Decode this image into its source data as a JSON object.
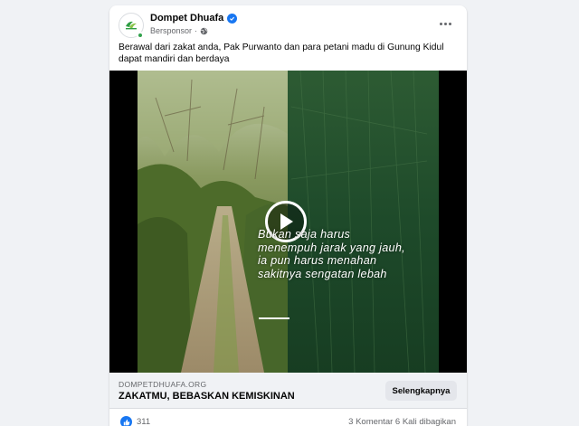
{
  "post": {
    "page_name": "Dompet Dhuafa",
    "sponsored_label": "Bersponsor",
    "caption": "Berawal dari zakat anda, Pak Purwanto dan para petani madu di Gunung Kidul dapat mandiri dan berdaya",
    "video_overlay_text": "Bukan saja harus menempuh jarak yang jauh, ia pun harus menahan sakitnya sengatan lebah"
  },
  "link": {
    "domain": "DOMPETDHUAFA.ORG",
    "headline": "ZAKATMU, BEBASKAN KEMISKINAN",
    "cta_label": "Selengkapnya"
  },
  "stats": {
    "reactions": "311",
    "comments": "3 Komentar",
    "shares": "6 Kali dibagikan"
  },
  "icons": {
    "verified": "verified-badge-icon",
    "globe": "globe-icon",
    "more": "more-options-icon",
    "play": "play-icon",
    "like": "like-reaction-icon"
  },
  "colors": {
    "accent": "#1877f2",
    "brand_green": "#2f9e44",
    "background": "#f0f2f5"
  }
}
